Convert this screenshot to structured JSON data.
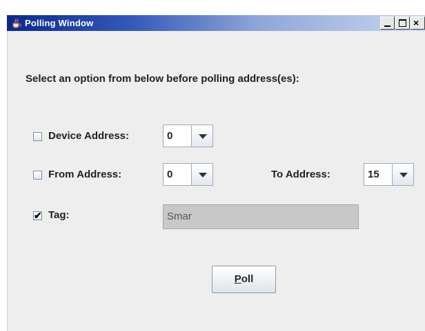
{
  "window": {
    "title": "Polling Window",
    "controls": {
      "minimize": "minimize",
      "maximize": "maximize",
      "close": "close"
    }
  },
  "prompt": "Select an option from below before polling address(es):",
  "device_address": {
    "checked": false,
    "label": "Device Address:",
    "value": "0"
  },
  "from_address": {
    "checked": false,
    "label": "From Address:",
    "value": "0"
  },
  "to_address": {
    "label": "To Address:",
    "value": "15"
  },
  "tag": {
    "checked": true,
    "label": "Tag:",
    "value": "Smar"
  },
  "poll_button": {
    "mnemonic": "P",
    "rest": "oll"
  },
  "icons": {
    "app": "java-cup-icon",
    "dropdown": "chevron-down-icon",
    "check": "check-icon"
  }
}
